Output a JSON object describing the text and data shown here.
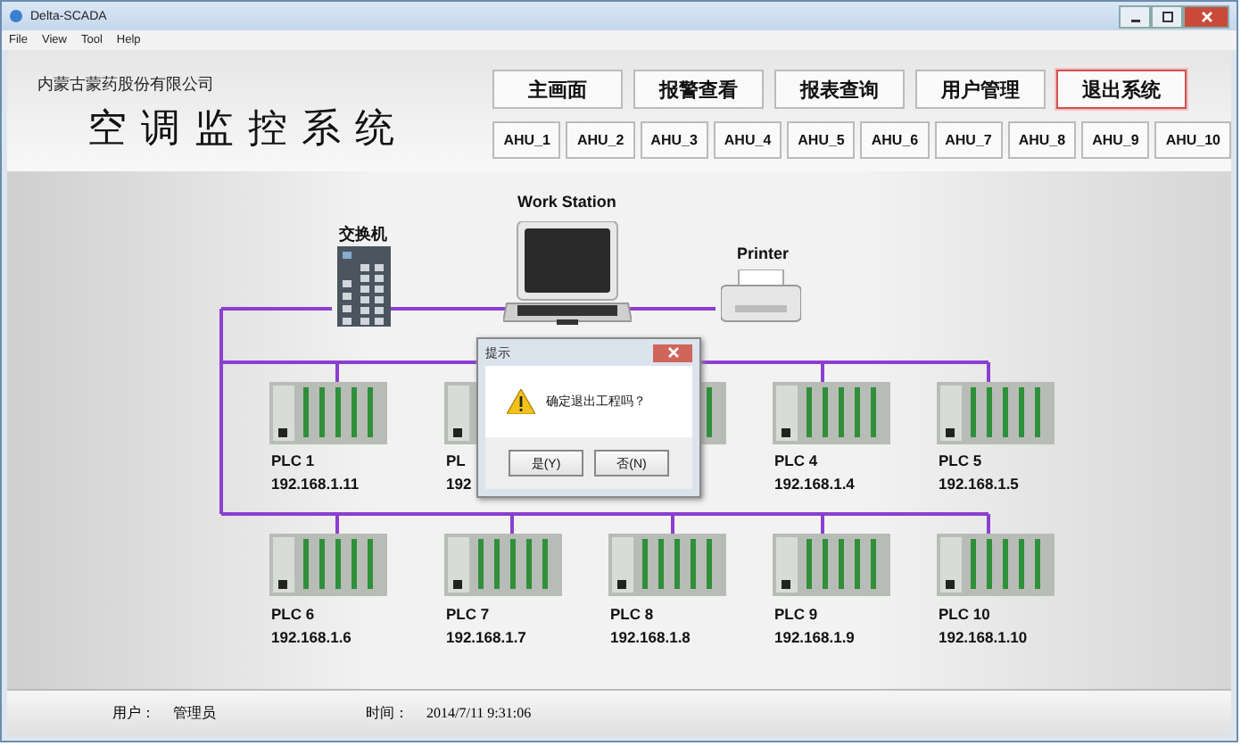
{
  "window": {
    "title": "Delta-SCADA"
  },
  "menu": [
    "File",
    "View",
    "Tool",
    "Help"
  ],
  "header": {
    "company": "内蒙古蒙药股份有限公司",
    "title": "空调监控系统"
  },
  "nav_buttons": [
    {
      "label": "主画面",
      "highlighted": false
    },
    {
      "label": "报警查看",
      "highlighted": false
    },
    {
      "label": "报表查询",
      "highlighted": false
    },
    {
      "label": "用户管理",
      "highlighted": false
    },
    {
      "label": "退出系统",
      "highlighted": true
    }
  ],
  "ahu_buttons": [
    "AHU_1",
    "AHU_2",
    "AHU_3",
    "AHU_4",
    "AHU_5",
    "AHU_6",
    "AHU_7",
    "AHU_8",
    "AHU_9",
    "AHU_10"
  ],
  "network": {
    "switch_label": "交换机",
    "workstation_label": "Work Station",
    "printer_label": "Printer",
    "plcs": [
      {
        "name": "PLC 1",
        "ip": "192.168.1.11"
      },
      {
        "name": "PL",
        "ip": "192"
      },
      {
        "name": "PLC 4",
        "ip": "192.168.1.4"
      },
      {
        "name": "PLC 5",
        "ip": "192.168.1.5"
      },
      {
        "name": "PLC 6",
        "ip": "192.168.1.6"
      },
      {
        "name": "PLC 7",
        "ip": "192.168.1.7"
      },
      {
        "name": "PLC 8",
        "ip": "192.168.1.8"
      },
      {
        "name": "PLC 9",
        "ip": "192.168.1.9"
      },
      {
        "name": "PLC 10",
        "ip": "192.168.1.10"
      }
    ]
  },
  "dialog": {
    "title": "提示",
    "message": "确定退出工程吗？",
    "buttons": [
      "是(Y)",
      "否(N)"
    ]
  },
  "status_bar": {
    "user_label": "用户：",
    "user": "管理员",
    "time_label": "时间：",
    "time": "2014/7/11 9:31:06"
  }
}
